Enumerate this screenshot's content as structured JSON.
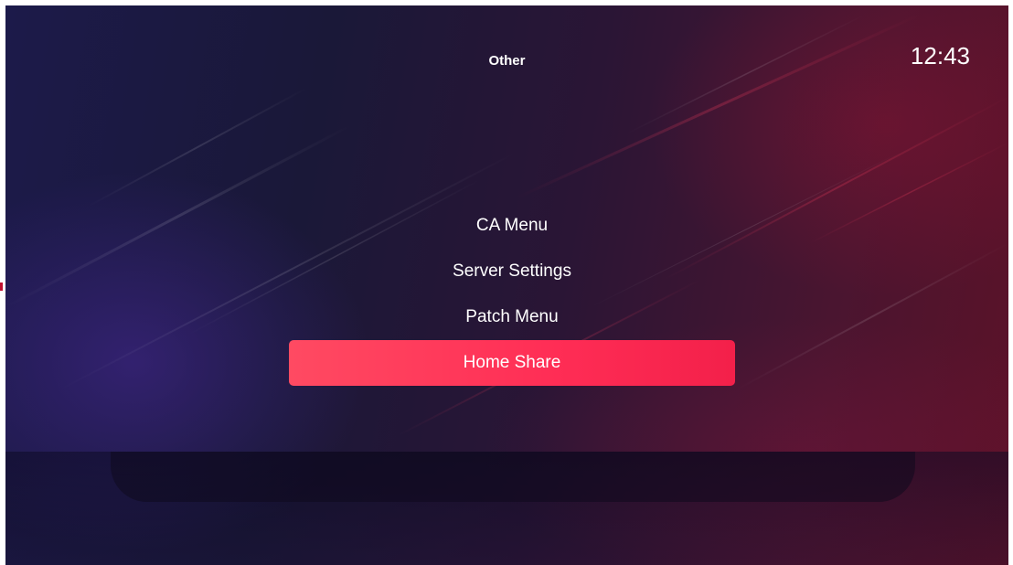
{
  "header": {
    "title": "Other",
    "clock": "12:43"
  },
  "menu": {
    "items": [
      {
        "label": "CA Menu",
        "selected": false
      },
      {
        "label": "Server Settings",
        "selected": false
      },
      {
        "label": "Patch Menu",
        "selected": false
      },
      {
        "label": "Home Share",
        "selected": true
      }
    ]
  },
  "colors": {
    "accent": "#ff3358",
    "background_dark": "#1a1838",
    "background_red": "#5c1228",
    "text": "#ffffff"
  }
}
